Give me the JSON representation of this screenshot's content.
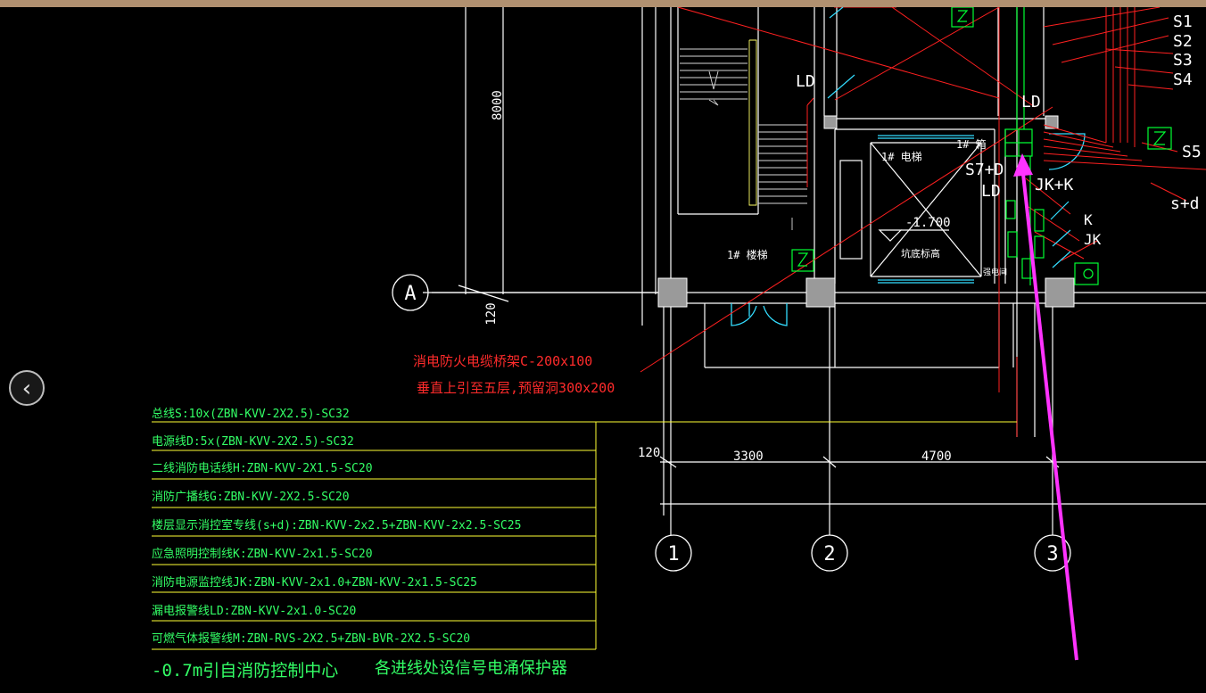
{
  "colors": {
    "background": "#000000",
    "wall": "#ffffff",
    "cable": "#ff2020",
    "device": "#00ff33",
    "legend_border": "#ffff33",
    "pointer": "#ff33ff",
    "door": "#33ddff",
    "column": "#9a9a9a"
  },
  "nav": {
    "back_icon": "‹"
  },
  "dimensions": {
    "height_8000": "8000",
    "axis_a_offset": "120",
    "bottom_offset": "120",
    "span_1_2": "3300",
    "span_2_3": "4700"
  },
  "axes": {
    "row_a": "A",
    "col_1": "1",
    "col_2": "2",
    "col_3": "3"
  },
  "room_labels": {
    "stair": "1# 楼梯",
    "elevator": "1# 电梯",
    "elevator_pit": "坑底标高",
    "elevator_level": "-1.700",
    "cabinet_1": "1# 箱",
    "electric_room": "强电间"
  },
  "signal_labels": {
    "s1": "S1",
    "s2": "S2",
    "s3": "S3",
    "s4": "S4",
    "s5": "S5",
    "sd": "s+d",
    "ld_top": "LD",
    "ld_mid": "LD",
    "ld_left": "LD",
    "ld_shaft": "LD",
    "s7": "S7+D",
    "jkk": "JK+K",
    "k": "K",
    "jk": "JK"
  },
  "annotations": {
    "tray_line1": "消电防火电缆桥架C-200x100",
    "tray_line2": "垂直上引至五层,预留洞300x200"
  },
  "legend": [
    "总线S:10x(ZBN-KVV-2X2.5)-SC32",
    "电源线D:5x(ZBN-KVV-2X2.5)-SC32",
    "二线消防电话线H:ZBN-KVV-2X1.5-SC20",
    "消防广播线G:ZBN-KVV-2X2.5-SC20",
    "楼层显示消控室专线(s+d):ZBN-KVV-2x2.5+ZBN-KVV-2x2.5-SC25",
    "应急照明控制线K:ZBN-KVV-2x1.5-SC20",
    "消防电源监控线JK:ZBN-KVV-2x1.0+ZBN-KVV-2x1.5-SC25",
    "漏电报警线LD:ZBN-KVV-2x1.0-SC20",
    "可燃气体报警线M:ZBN-RVS-2X2.5+ZBN-BVR-2X2.5-SC20"
  ],
  "footer": {
    "left": "-0.7m引自消防控制中心",
    "right": "各进线处设信号电涌保护器"
  }
}
